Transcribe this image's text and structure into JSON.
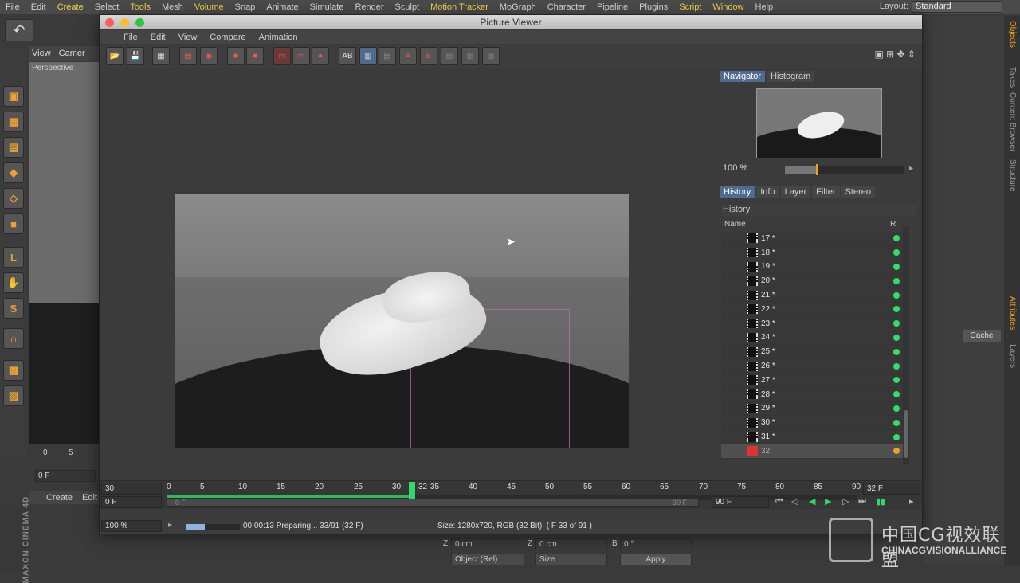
{
  "app": {
    "menus": [
      "File",
      "Edit",
      "Create",
      "Select",
      "Tools",
      "Mesh",
      "Volume",
      "Snap",
      "Animate",
      "Simulate",
      "Render",
      "Sculpt",
      "Motion Tracker",
      "MoGraph",
      "Character",
      "Pipeline",
      "Plugins",
      "Script",
      "Window",
      "Help"
    ],
    "highlighted_menus": [
      "Create",
      "Tools",
      "Volume",
      "Motion Tracker",
      "Script",
      "Window"
    ],
    "layout_label": "Layout:",
    "layout_value": "Standard"
  },
  "viewport": {
    "tabs": [
      "View",
      "Camer"
    ],
    "label": "Perspective",
    "frame_field": "0 F",
    "ruler": [
      "0",
      "5"
    ],
    "bottom_menu": [
      "Create",
      "Edit"
    ]
  },
  "side_labels": {
    "maxon": "MAXON CINEMA 4D",
    "right_strip": [
      "Objects",
      "Takes",
      "Content Browser",
      "Structure",
      "Attributes",
      "Layers"
    ],
    "cache_button": "Cache"
  },
  "picture_viewer": {
    "title": "Picture Viewer",
    "menu": [
      "File",
      "Edit",
      "View",
      "Compare",
      "Animation"
    ],
    "nav_tabs": [
      "Navigator",
      "Histogram"
    ],
    "zoom": "100 %",
    "zoom_fraction": 0.26,
    "info_tabs": [
      "History",
      "Info",
      "Layer",
      "Filter",
      "Stereo"
    ],
    "history_label": "History",
    "columns": {
      "name": "Name",
      "r": "R"
    },
    "history_rows": [
      "17 *",
      "18 *",
      "19 *",
      "20 *",
      "21 *",
      "22 *",
      "23 *",
      "24 *",
      "25 *",
      "26 *",
      "27 *",
      "28 *",
      "29 *",
      "30 *",
      "31 *",
      "32"
    ],
    "current_row": "32",
    "timeline": {
      "left_top": "30",
      "left_bottom": "0 F",
      "ticks": [
        "0",
        "5",
        "10",
        "15",
        "20",
        "25",
        "30",
        "32",
        "35",
        "40",
        "45",
        "50",
        "55",
        "60",
        "65",
        "70",
        "75",
        "80",
        "85",
        "90"
      ],
      "scrub_start": "0 F",
      "scrub_end": "90 F",
      "end_field": "90 F",
      "right_field": "32 F",
      "current_frame": 32,
      "max_frame": 91
    },
    "status": {
      "zoom": "100 %",
      "progress_text": "00:00:13 Preparing... 33/91 (32 F)",
      "progress_fraction": 0.36,
      "size_text": "Size: 1280x720, RGB (32 Bit),  ( F 33 of 91 )"
    }
  },
  "attributes": {
    "z1_label": "Z",
    "z1_value": "0 cm",
    "z2_label": "Z",
    "z2_value": "0 cm",
    "b_label": "B",
    "b_value": "0 °",
    "coord_mode": "Object (Rel)",
    "mode2": "Size",
    "apply": "Apply"
  },
  "watermark": {
    "cn": "中国CG视效联盟",
    "en": "CHINACGVISIONALLIANCE"
  },
  "colors": {
    "accent_green": "#35d56b",
    "tab_selected": "#4f6b8f",
    "menu_highlight": "#f0d44a",
    "status_dot": "#33dd66",
    "current_dot": "#f0a020"
  }
}
